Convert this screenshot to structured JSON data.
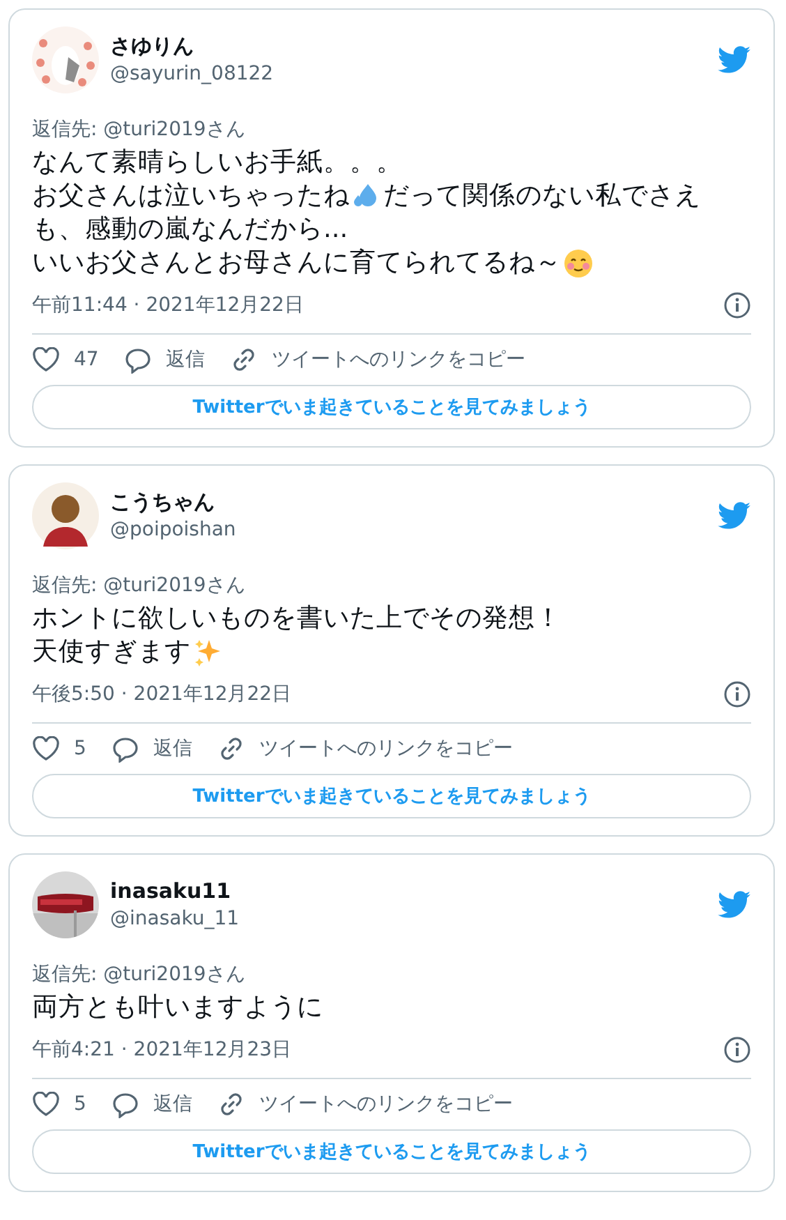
{
  "tweets": [
    {
      "avatar": {
        "kind": "picture"
      },
      "name": "さゆりん",
      "handle": "@sayurin_08122",
      "reply_to": "返信先: @turi2019さん",
      "body": [
        [
          {
            "kind": "text",
            "text": "なんて素晴らしいお手紙。。。"
          }
        ],
        [
          {
            "kind": "text",
            "text": "お父さんは泣いちゃったね"
          },
          {
            "kind": "droplets"
          },
          {
            "kind": "text",
            "text": "だって関係のない私でさえ"
          }
        ],
        [
          {
            "kind": "text",
            "text": "も、感動の嵐なんだから..."
          }
        ],
        [
          {
            "kind": "text",
            "text": "いいお父さんとお母さんに育てられてるね～"
          },
          {
            "kind": "blush"
          }
        ]
      ],
      "time": "午前11:44 · 2021年12月22日",
      "likes": "47",
      "reply": "返信",
      "copy_link": "ツイートへのリンクをコピー",
      "cta": "Twitterでいま起きていることを見てみましょう"
    },
    {
      "avatar": {
        "kind": "silhouette"
      },
      "name": "こうちゃん",
      "handle": "@poipoishan",
      "reply_to": "返信先: @turi2019さん",
      "body": [
        [
          {
            "kind": "text",
            "text": "ホントに欲しいものを書いた上でその発想！"
          }
        ],
        [
          {
            "kind": "text",
            "text": "天使すぎます"
          },
          {
            "kind": "sparkles"
          }
        ]
      ],
      "time": "午後5:50 · 2021年12月22日",
      "likes": "5",
      "reply": "返信",
      "copy_link": "ツイートへのリンクをコピー",
      "cta": "Twitterでいま起きていることを見てみましょう"
    },
    {
      "avatar": {
        "kind": "picture"
      },
      "name": "inasaku11",
      "handle": "@inasaku_11",
      "reply_to": "返信先: @turi2019さん",
      "body": [
        [
          {
            "kind": "text",
            "text": "両方とも叶いますように"
          }
        ]
      ],
      "time": "午前4:21 · 2021年12月23日",
      "likes": "5",
      "reply": "返信",
      "copy_link": "ツイートへのリンクをコピー",
      "cta": "Twitterでいま起きていることを見てみましょう"
    }
  ]
}
